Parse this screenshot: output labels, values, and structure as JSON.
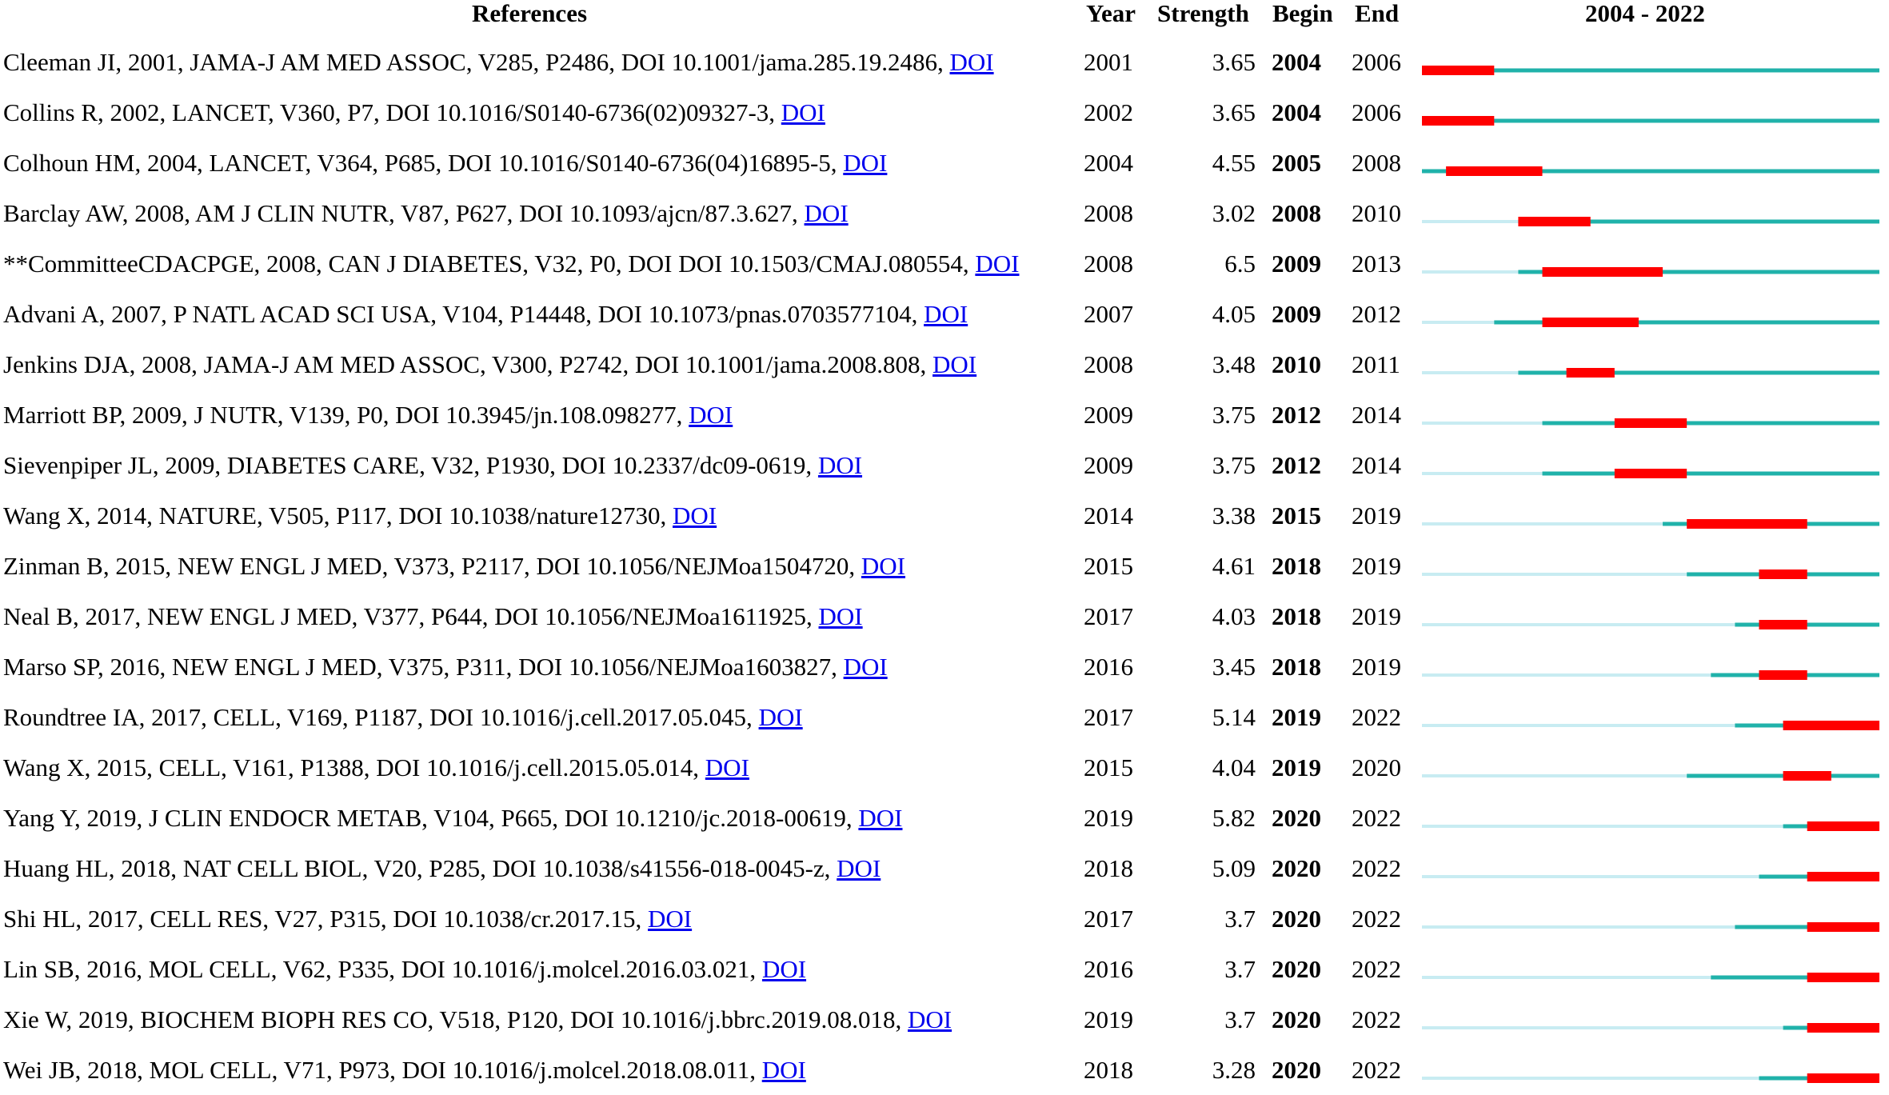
{
  "headers": {
    "references": "References",
    "year": "Year",
    "strength": "Strength",
    "begin": "Begin",
    "end": "End",
    "range": "2004 - 2022"
  },
  "chart_data": {
    "type": "burst-timeline",
    "range": [
      2004,
      2022
    ],
    "colors": {
      "burst": "#ff0000",
      "active": "#20b2aa",
      "inactive": "#c8ecf2"
    },
    "rows": [
      {
        "ref": "Cleeman JI, 2001, JAMA-J AM MED ASSOC, V285, P2486, DOI 10.1001/jama.285.19.2486, ",
        "doi": "DOI",
        "year": "2001",
        "strength": "3.65",
        "begin": "2004",
        "end": "2006"
      },
      {
        "ref": "Collins R, 2002, LANCET, V360, P7, DOI 10.1016/S0140-6736(02)09327-3, ",
        "doi": "DOI",
        "year": "2002",
        "strength": "3.65",
        "begin": "2004",
        "end": "2006"
      },
      {
        "ref": "Colhoun HM, 2004, LANCET, V364, P685, DOI 10.1016/S0140-6736(04)16895-5, ",
        "doi": "DOI",
        "year": "2004",
        "strength": "4.55",
        "begin": "2005",
        "end": "2008"
      },
      {
        "ref": "Barclay AW, 2008, AM J CLIN NUTR, V87, P627, DOI 10.1093/ajcn/87.3.627, ",
        "doi": "DOI",
        "year": "2008",
        "strength": "3.02",
        "begin": "2008",
        "end": "2010"
      },
      {
        "ref": "**CommitteeCDACPGE, 2008, CAN J DIABETES, V32, P0, DOI DOI 10.1503/CMAJ.080554, ",
        "doi": "DOI",
        "year": "2008",
        "strength": "6.5",
        "begin": "2009",
        "end": "2013"
      },
      {
        "ref": "Advani A, 2007, P NATL ACAD SCI USA, V104, P14448, DOI 10.1073/pnas.0703577104, ",
        "doi": "DOI",
        "year": "2007",
        "strength": "4.05",
        "begin": "2009",
        "end": "2012"
      },
      {
        "ref": "Jenkins DJA, 2008, JAMA-J AM MED ASSOC, V300, P2742, DOI 10.1001/jama.2008.808, ",
        "doi": "DOI",
        "year": "2008",
        "strength": "3.48",
        "begin": "2010",
        "end": "2011"
      },
      {
        "ref": "Marriott BP, 2009, J NUTR, V139, P0, DOI 10.3945/jn.108.098277, ",
        "doi": "DOI",
        "year": "2009",
        "strength": "3.75",
        "begin": "2012",
        "end": "2014"
      },
      {
        "ref": "Sievenpiper JL, 2009, DIABETES CARE, V32, P1930, DOI 10.2337/dc09-0619, ",
        "doi": "DOI",
        "year": "2009",
        "strength": "3.75",
        "begin": "2012",
        "end": "2014"
      },
      {
        "ref": "Wang X, 2014, NATURE, V505, P117, DOI 10.1038/nature12730, ",
        "doi": "DOI",
        "year": "2014",
        "strength": "3.38",
        "begin": "2015",
        "end": "2019"
      },
      {
        "ref": "Zinman B, 2015, NEW ENGL J MED, V373, P2117, DOI 10.1056/NEJMoa1504720, ",
        "doi": "DOI",
        "year": "2015",
        "strength": "4.61",
        "begin": "2018",
        "end": "2019"
      },
      {
        "ref": "Neal B, 2017, NEW ENGL J MED, V377, P644, DOI 10.1056/NEJMoa1611925, ",
        "doi": "DOI",
        "year": "2017",
        "strength": "4.03",
        "begin": "2018",
        "end": "2019"
      },
      {
        "ref": "Marso SP, 2016, NEW ENGL J MED, V375, P311, DOI 10.1056/NEJMoa1603827, ",
        "doi": "DOI",
        "year": "2016",
        "strength": "3.45",
        "begin": "2018",
        "end": "2019"
      },
      {
        "ref": "Roundtree IA, 2017, CELL, V169, P1187, DOI 10.1016/j.cell.2017.05.045, ",
        "doi": "DOI",
        "year": "2017",
        "strength": "5.14",
        "begin": "2019",
        "end": "2022"
      },
      {
        "ref": "Wang X, 2015, CELL, V161, P1388, DOI 10.1016/j.cell.2015.05.014, ",
        "doi": "DOI",
        "year": "2015",
        "strength": "4.04",
        "begin": "2019",
        "end": "2020"
      },
      {
        "ref": "Yang Y, 2019, J CLIN ENDOCR METAB, V104, P665, DOI 10.1210/jc.2018-00619, ",
        "doi": "DOI",
        "year": "2019",
        "strength": "5.82",
        "begin": "2020",
        "end": "2022"
      },
      {
        "ref": "Huang HL, 2018, NAT CELL BIOL, V20, P285, DOI 10.1038/s41556-018-0045-z, ",
        "doi": "DOI",
        "year": "2018",
        "strength": "5.09",
        "begin": "2020",
        "end": "2022"
      },
      {
        "ref": "Shi HL, 2017, CELL RES, V27, P315, DOI 10.1038/cr.2017.15, ",
        "doi": "DOI",
        "year": "2017",
        "strength": "3.7",
        "begin": "2020",
        "end": "2022"
      },
      {
        "ref": "Lin SB, 2016, MOL CELL, V62, P335, DOI 10.1016/j.molcel.2016.03.021, ",
        "doi": "DOI",
        "year": "2016",
        "strength": "3.7",
        "begin": "2020",
        "end": "2022"
      },
      {
        "ref": "Xie W, 2019, BIOCHEM BIOPH RES CO, V518, P120, DOI 10.1016/j.bbrc.2019.08.018, ",
        "doi": "DOI",
        "year": "2019",
        "strength": "3.7",
        "begin": "2020",
        "end": "2022"
      },
      {
        "ref": "Wei JB, 2018, MOL CELL, V71, P973, DOI 10.1016/j.molcel.2018.08.011, ",
        "doi": "DOI",
        "year": "2018",
        "strength": "3.28",
        "begin": "2020",
        "end": "2022"
      }
    ]
  }
}
